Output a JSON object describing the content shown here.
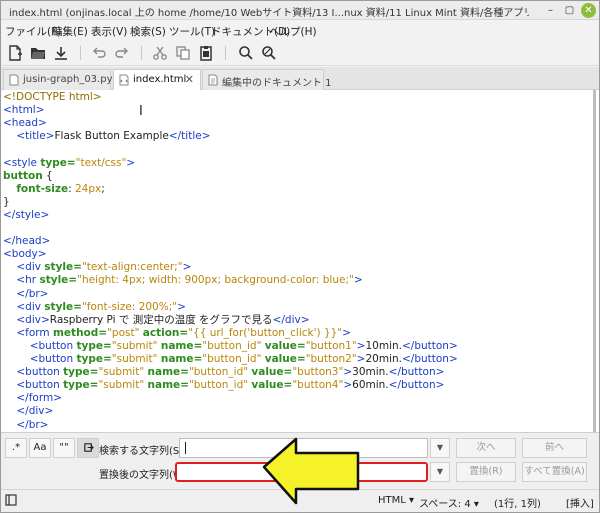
{
  "window": {
    "title": "index.html (onjinas.local 上の home /home/10 Webサイト資料/13 I...nux 資料/11 Linux Mint 資料/各種アプリの使い方/アプリ テスト用データ) - Pluma",
    "close_glyph": "✕",
    "min_glyph": "–",
    "max_glyph": "▢"
  },
  "menu": [
    "ファイル(F)",
    "編集(E)",
    "表示(V)",
    "検索(S)",
    "ツール(T)",
    "ドキュメント(D)",
    "ヘルプ(H)"
  ],
  "toolbar_icons": [
    "new-document-icon",
    "open-icon",
    "save-icon",
    "undo-icon",
    "redo-icon",
    "cut-icon",
    "copy-icon",
    "paste-icon",
    "search-icon",
    "search-replace-icon"
  ],
  "tabs": [
    {
      "label": "jusin-graph_03.py",
      "close": "✕",
      "icon": "python-file-icon"
    },
    {
      "label": "index.html",
      "close": "✕",
      "icon": "html-file-icon"
    },
    {
      "label": "編集中のドキュメント 1",
      "close": "✕",
      "icon": "text-file-icon"
    }
  ],
  "code": [
    {
      "indent": "",
      "parts": [
        [
          "doc",
          "<!DOCTYPE html>"
        ]
      ]
    },
    {
      "indent": "",
      "parts": [
        [
          "tag",
          "<html>"
        ]
      ]
    },
    {
      "indent": "",
      "parts": [
        [
          "tag",
          "<head>"
        ]
      ]
    },
    {
      "indent": "    ",
      "parts": [
        [
          "tag",
          "<title>"
        ],
        [
          "text",
          "Flask Button Example"
        ],
        [
          "tag",
          "</title>"
        ]
      ]
    },
    {
      "indent": "",
      "parts": []
    },
    {
      "indent": "",
      "parts": [
        [
          "tag",
          "<style "
        ],
        [
          "attr",
          "type="
        ],
        [
          "val",
          "\"text/css\""
        ],
        [
          "tag",
          ">"
        ]
      ]
    },
    {
      "indent": "",
      "parts": [
        [
          "sel",
          "button"
        ],
        [
          "text",
          " {"
        ]
      ]
    },
    {
      "indent": "    ",
      "parts": [
        [
          "prop",
          "font-size"
        ],
        [
          "text",
          ": "
        ],
        [
          "num",
          "24px"
        ],
        [
          "text",
          ";"
        ]
      ]
    },
    {
      "indent": "",
      "parts": [
        [
          "text",
          "}"
        ]
      ]
    },
    {
      "indent": "",
      "parts": [
        [
          "tag",
          "</style>"
        ]
      ]
    },
    {
      "indent": "",
      "parts": []
    },
    {
      "indent": "",
      "parts": [
        [
          "tag",
          "</head>"
        ]
      ]
    },
    {
      "indent": "",
      "parts": [
        [
          "tag",
          "<body>"
        ]
      ]
    },
    {
      "indent": "    ",
      "parts": [
        [
          "tag",
          "<div "
        ],
        [
          "attr",
          "style="
        ],
        [
          "val",
          "\"text-align:center;\""
        ],
        [
          "tag",
          ">"
        ]
      ]
    },
    {
      "indent": "    ",
      "parts": [
        [
          "tag",
          "<hr "
        ],
        [
          "attr",
          "style="
        ],
        [
          "val",
          "\"height: 4px; width: 900px; background-color: blue;\""
        ],
        [
          "tag",
          ">"
        ]
      ]
    },
    {
      "indent": "    ",
      "parts": [
        [
          "tag",
          "</br>"
        ]
      ]
    },
    {
      "indent": "    ",
      "parts": [
        [
          "tag",
          "<div "
        ],
        [
          "attr",
          "style="
        ],
        [
          "val",
          "\"font-size: 200%;\""
        ],
        [
          "tag",
          ">"
        ]
      ]
    },
    {
      "indent": "    ",
      "parts": [
        [
          "tag",
          "<div>"
        ],
        [
          "text",
          "Raspberry Pi で 測定中の温度 をグラフで見る"
        ],
        [
          "tag",
          "</div>"
        ]
      ]
    },
    {
      "indent": "    ",
      "parts": [
        [
          "tag",
          "<form "
        ],
        [
          "attr",
          "method="
        ],
        [
          "val",
          "\"post\" "
        ],
        [
          "attr",
          "action="
        ],
        [
          "val",
          "\"{{ url_for('button_click') }}\""
        ],
        [
          "tag",
          ">"
        ]
      ]
    },
    {
      "indent": "        ",
      "parts": [
        [
          "tag",
          "<button "
        ],
        [
          "attr",
          "type="
        ],
        [
          "val",
          "\"submit\" "
        ],
        [
          "attr",
          "name="
        ],
        [
          "val",
          "\"button_id\" "
        ],
        [
          "attr",
          "value="
        ],
        [
          "val",
          "\"button1\""
        ],
        [
          "tag",
          ">"
        ],
        [
          "text",
          "10min."
        ],
        [
          "tag",
          "</button>"
        ]
      ]
    },
    {
      "indent": "        ",
      "parts": [
        [
          "tag",
          "<button "
        ],
        [
          "attr",
          "type="
        ],
        [
          "val",
          "\"submit\" "
        ],
        [
          "attr",
          "name="
        ],
        [
          "val",
          "\"button_id\" "
        ],
        [
          "attr",
          "value="
        ],
        [
          "val",
          "\"button2\""
        ],
        [
          "tag",
          ">"
        ],
        [
          "text",
          "20min."
        ],
        [
          "tag",
          "</button>"
        ]
      ]
    },
    {
      "indent": "    ",
      "parts": [
        [
          "tag",
          "<button "
        ],
        [
          "attr",
          "type="
        ],
        [
          "val",
          "\"submit\" "
        ],
        [
          "attr",
          "name="
        ],
        [
          "val",
          "\"button_id\" "
        ],
        [
          "attr",
          "value="
        ],
        [
          "val",
          "\"button3\""
        ],
        [
          "tag",
          ">"
        ],
        [
          "text",
          "30min."
        ],
        [
          "tag",
          "</button>"
        ]
      ]
    },
    {
      "indent": "    ",
      "parts": [
        [
          "tag",
          "<button "
        ],
        [
          "attr",
          "type="
        ],
        [
          "val",
          "\"submit\" "
        ],
        [
          "attr",
          "name="
        ],
        [
          "val",
          "\"button_id\" "
        ],
        [
          "attr",
          "value="
        ],
        [
          "val",
          "\"button4\""
        ],
        [
          "tag",
          ">"
        ],
        [
          "text",
          "60min."
        ],
        [
          "tag",
          "</button>"
        ]
      ]
    },
    {
      "indent": "    ",
      "parts": [
        [
          "tag",
          "</form>"
        ]
      ]
    },
    {
      "indent": "    ",
      "parts": [
        [
          "tag",
          "</div>"
        ]
      ]
    },
    {
      "indent": "    ",
      "parts": [
        [
          "tag",
          "</br>"
        ]
      ]
    }
  ],
  "search": {
    "regex_label": ".*",
    "case_label": "Aa",
    "word_label": "\"\"",
    "find_label": "検索する文字列(S):",
    "find_value": "",
    "replace_label": "置換後の文字列(W):",
    "replace_value": "",
    "next": "次へ",
    "prev": "前へ",
    "replace": "置換(R)",
    "replace_all": "すべて置換(A)"
  },
  "status": {
    "language": "HTML",
    "tab_width": "スペース: 4",
    "position": "(1行, 1列)",
    "mode": "[挿入]"
  },
  "colors": {
    "highlight_border": "#e41e1e",
    "arrow_fill": "#f5f22a",
    "arrow_stroke": "#111111"
  }
}
